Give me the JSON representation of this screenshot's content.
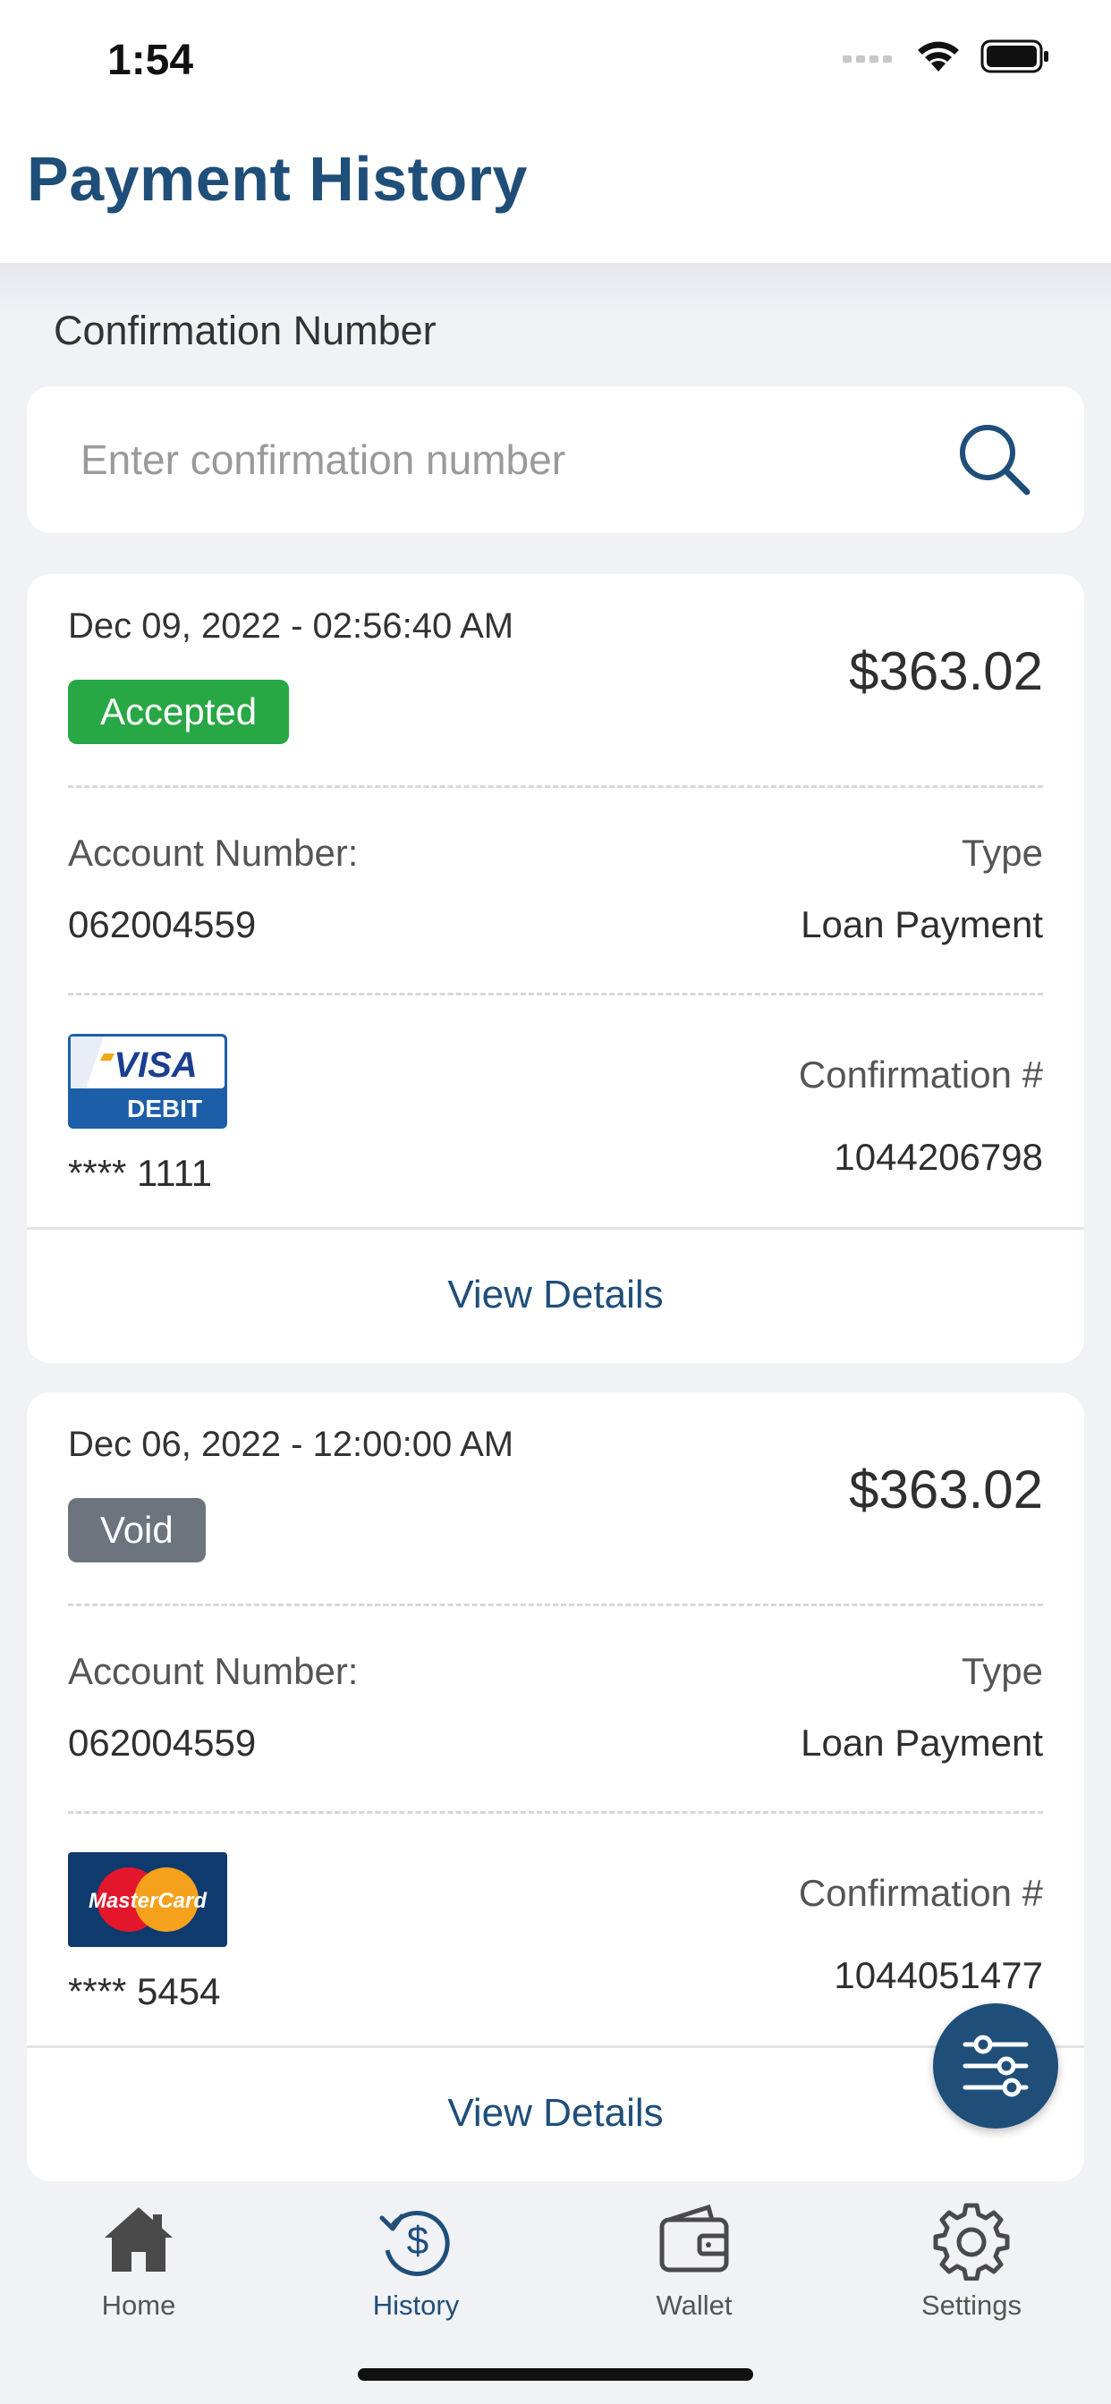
{
  "status": {
    "time": "1:54"
  },
  "header": {
    "title": "Payment History"
  },
  "search": {
    "label": "Confirmation Number",
    "placeholder": "Enter confirmation number"
  },
  "colors": {
    "brand": "#1f4e79",
    "accepted": "#28a745",
    "void": "#6c757d"
  },
  "payments": [
    {
      "date": "Dec 09, 2022 - 02:56:40 AM",
      "amount": "$363.02",
      "status": "Accepted",
      "account_label": "Account Number:",
      "account_number": "062004559",
      "type_label": "Type",
      "type": "Loan Payment",
      "card_brand": "visa-debit",
      "card_logo_text": "VISA",
      "card_logo_subtext": "DEBIT",
      "card_masked": "**** 1111",
      "confirmation_label": "Confirmation #",
      "confirmation_number": "1044206798",
      "action": "View Details"
    },
    {
      "date": "Dec 06, 2022 - 12:00:00 AM",
      "amount": "$363.02",
      "status": "Void",
      "account_label": "Account Number:",
      "account_number": "062004559",
      "type_label": "Type",
      "type": "Loan Payment",
      "card_brand": "mastercard",
      "card_logo_text": "MasterCard",
      "card_masked": "**** 5454",
      "confirmation_label": "Confirmation #",
      "confirmation_number": "1044051477",
      "action": "View Details"
    }
  ],
  "fab": {
    "icon": "filter-sliders-icon"
  },
  "tabs": [
    {
      "label": "Home",
      "icon": "home-icon",
      "active": false
    },
    {
      "label": "History",
      "icon": "history-dollar-icon",
      "active": true
    },
    {
      "label": "Wallet",
      "icon": "wallet-icon",
      "active": false
    },
    {
      "label": "Settings",
      "icon": "gear-icon",
      "active": false
    }
  ]
}
